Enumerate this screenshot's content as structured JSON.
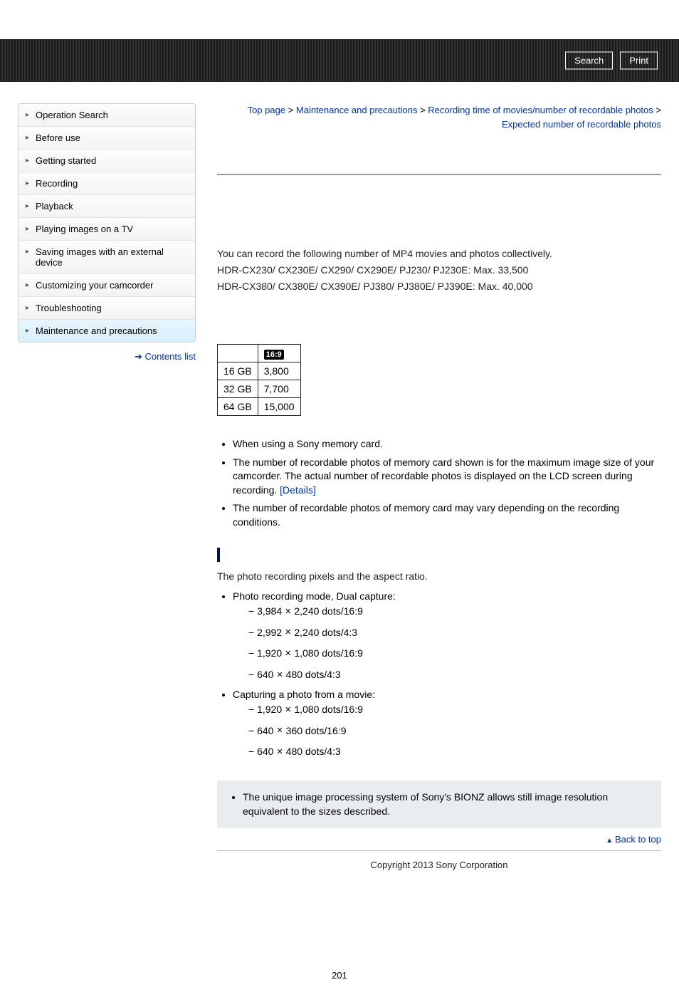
{
  "topbar": {
    "search": "Search",
    "print": "Print"
  },
  "sidebar": {
    "items": [
      "Operation Search",
      "Before use",
      "Getting started",
      "Recording",
      "Playback",
      "Playing images on a TV",
      "Saving images with an external device",
      "Customizing your camcorder",
      "Troubleshooting",
      "Maintenance and precautions"
    ],
    "contents_link": "Contents list"
  },
  "breadcrumb": {
    "top": "Top page",
    "cat": "Maintenance and precautions",
    "sub": "Recording time of movies/number of recordable photos",
    "page": "Expected number of recordable photos"
  },
  "intro": {
    "l1": "You can record the following number of MP4 movies and photos collectively.",
    "l2": "HDR-CX230/ CX230E/ CX290/ CX290E/ PJ230/ PJ230E: Max. 33,500",
    "l3": "HDR-CX380/ CX380E/ CX390E/ PJ380/ PJ380E/ PJ390E: Max. 40,000"
  },
  "table": {
    "header_ratio": "16:9",
    "rows": [
      {
        "cap": "16 GB",
        "val": "3,800"
      },
      {
        "cap": "32 GB",
        "val": "7,700"
      },
      {
        "cap": "64 GB",
        "val": "15,000"
      }
    ]
  },
  "bullets1": {
    "b1": "When using a Sony memory card.",
    "b2a": "The number of recordable photos of memory card shown is for the maximum image size of your camcorder. The actual number of recordable photos is displayed on the LCD screen during recording. ",
    "b2_link": "[Details]",
    "b3": "The number of recordable photos of memory card may vary depending on the recording conditions."
  },
  "pixels": {
    "intro": "The photo recording pixels and the aspect ratio.",
    "mode1": "Photo recording mode, Dual capture:",
    "m1": [
      {
        "a": "3,984",
        "b": "2,240 dots/16:9"
      },
      {
        "a": "2,992",
        "b": "2,240 dots/4:3"
      },
      {
        "a": "1,920",
        "b": "1,080 dots/16:9"
      },
      {
        "a": "640",
        "b": "480 dots/4:3"
      }
    ],
    "mode2": "Capturing a photo from a movie:",
    "m2": [
      {
        "a": "1,920",
        "b": "1,080 dots/16:9"
      },
      {
        "a": "640",
        "b": "360 dots/16:9"
      },
      {
        "a": "640",
        "b": "480 dots/4:3"
      }
    ]
  },
  "note": "The unique image processing system of Sony's BIONZ allows still image resolution equivalent to the sizes described.",
  "backtop": "Back to top",
  "copyright": "Copyright 2013 Sony Corporation",
  "pagenum": "201"
}
